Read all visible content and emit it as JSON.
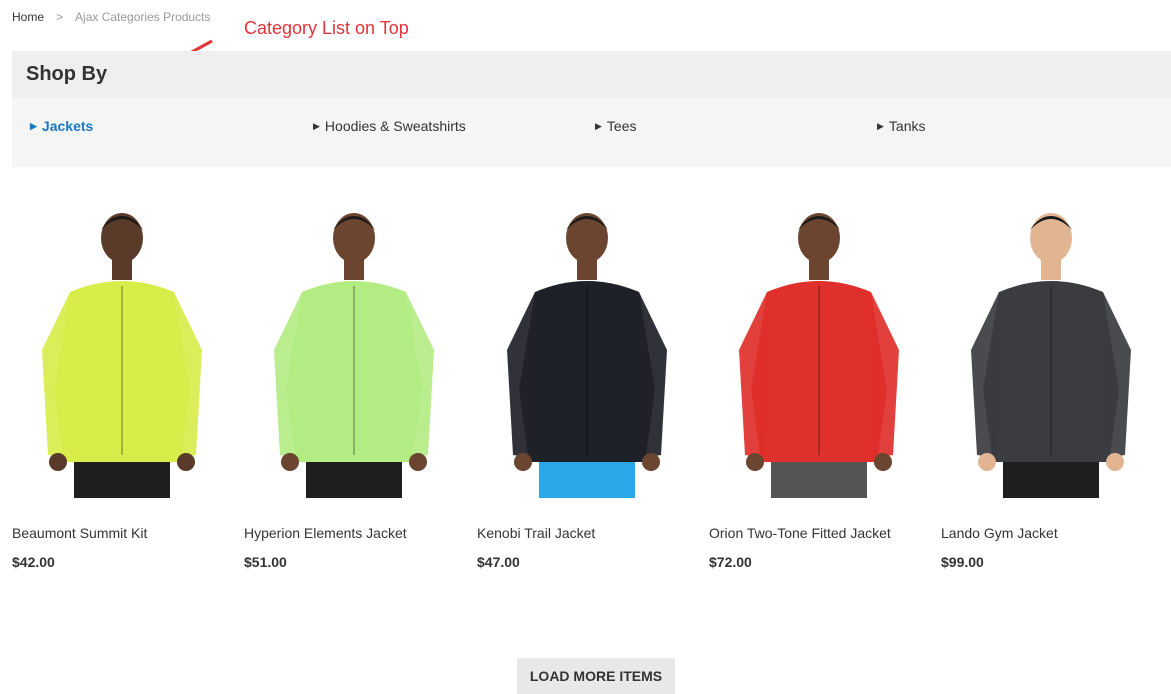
{
  "breadcrumb": {
    "home": "Home",
    "separator": ">",
    "current": "Ajax Categories Products"
  },
  "annotation": {
    "text": "Category List on Top",
    "color": "#e2343b"
  },
  "shop_by": {
    "title": "Shop By",
    "categories": [
      {
        "label": "Jackets",
        "active": true
      },
      {
        "label": "Hoodies & Sweatshirts",
        "active": false
      },
      {
        "label": "Tees",
        "active": false
      },
      {
        "label": "Tanks",
        "active": false
      }
    ]
  },
  "products": [
    {
      "name": "Beaumont Summit Kit",
      "price": "$42.00",
      "jacket_color": "#d8ec4a",
      "pants_color": "#1e1e1e",
      "skin": "#5a3a28"
    },
    {
      "name": "Hyperion Elements Jacket",
      "price": "$51.00",
      "jacket_color": "#b4ec84",
      "pants_color": "#1e1e1e",
      "skin": "#6b4530"
    },
    {
      "name": "Kenobi Trail Jacket",
      "price": "$47.00",
      "jacket_color": "#1f2128",
      "pants_color": "#2aa7e8",
      "skin": "#6b4530"
    },
    {
      "name": "Orion Two-Tone Fitted Jacket",
      "price": "$72.00",
      "jacket_color": "#e0302b",
      "pants_color": "#555555",
      "skin": "#6b4530"
    },
    {
      "name": "Lando Gym Jacket",
      "price": "$99.00",
      "jacket_color": "#3a3c40",
      "pants_color": "#1e1e1e",
      "skin": "#e2b592"
    }
  ],
  "load_more": {
    "label": "LOAD MORE ITEMS"
  },
  "colors": {
    "accent": "#1979c3",
    "panel": "#f5f5f5",
    "panel_header": "#efefef"
  }
}
